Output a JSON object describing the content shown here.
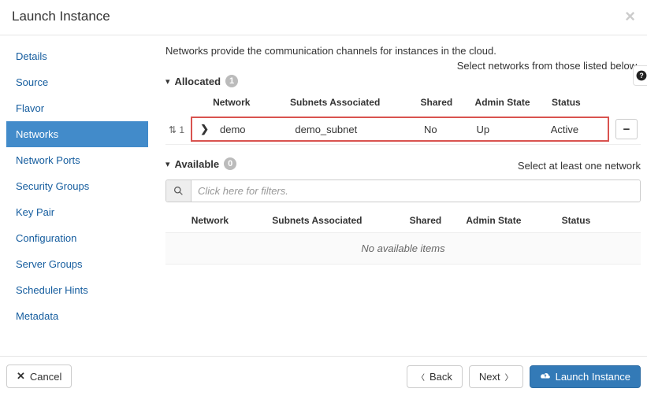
{
  "header": {
    "title": "Launch Instance"
  },
  "sidebar": {
    "items": [
      {
        "label": "Details"
      },
      {
        "label": "Source"
      },
      {
        "label": "Flavor"
      },
      {
        "label": "Networks"
      },
      {
        "label": "Network Ports"
      },
      {
        "label": "Security Groups"
      },
      {
        "label": "Key Pair"
      },
      {
        "label": "Configuration"
      },
      {
        "label": "Server Groups"
      },
      {
        "label": "Scheduler Hints"
      },
      {
        "label": "Metadata"
      }
    ],
    "active_index": 3
  },
  "main": {
    "description": "Networks provide the communication channels for instances in the cloud.",
    "select_hint": "Select networks from those listed below.",
    "allocated": {
      "label": "Allocated",
      "count": "1",
      "columns": {
        "network": "Network",
        "subnets": "Subnets Associated",
        "shared": "Shared",
        "admin": "Admin State",
        "status": "Status"
      },
      "row": {
        "order": "1",
        "network": "demo",
        "subnets": "demo_subnet",
        "shared": "No",
        "admin": "Up",
        "status": "Active"
      }
    },
    "available": {
      "label": "Available",
      "count": "0",
      "hint": "Select at least one network",
      "filter_placeholder": "Click here for filters.",
      "columns": {
        "network": "Network",
        "subnets": "Subnets Associated",
        "shared": "Shared",
        "admin": "Admin State",
        "status": "Status"
      },
      "empty": "No available items"
    }
  },
  "footer": {
    "cancel": "Cancel",
    "back": "Back",
    "next": "Next",
    "launch": "Launch Instance"
  }
}
